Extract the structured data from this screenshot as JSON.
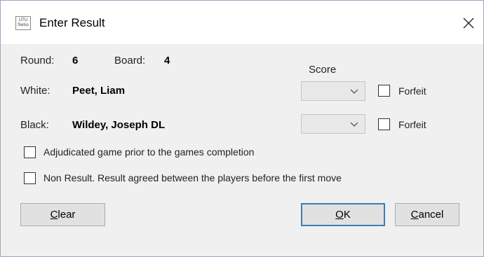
{
  "window": {
    "title": "Enter Result",
    "app_icon_text_1": "UTU",
    "app_icon_text_2": "Swiss",
    "close_label": "×"
  },
  "game": {
    "round_label": "Round:",
    "round_value": "6",
    "board_label": "Board:",
    "board_value": "4",
    "score_header": "Score"
  },
  "white": {
    "label": "White:",
    "name": "Peet, Liam",
    "score_value": "",
    "forfeit_label": "Forfeit",
    "forfeit_checked": false
  },
  "black": {
    "label": "Black:",
    "name": "Wildey, Joseph DL",
    "score_value": "",
    "forfeit_label": "Forfeit",
    "forfeit_checked": false
  },
  "options": {
    "adjudicated_label": "Adjudicated game prior to the games completion",
    "adjudicated_checked": false,
    "non_result_label": "Non Result. Result agreed between the players before the first move",
    "non_result_checked": false
  },
  "buttons": {
    "clear_mnemonic": "C",
    "clear_rest": "lear",
    "ok_mnemonic": "O",
    "ok_rest": "K",
    "cancel_mnemonic": "C",
    "cancel_rest": "ancel"
  },
  "colors": {
    "titlebar_bg": "#ffffff",
    "dialog_bg": "#f0f0f0",
    "default_button_border": "#3c7fb1"
  },
  "icons": [
    "app-icon",
    "close-icon",
    "chevron-down-icon"
  ]
}
